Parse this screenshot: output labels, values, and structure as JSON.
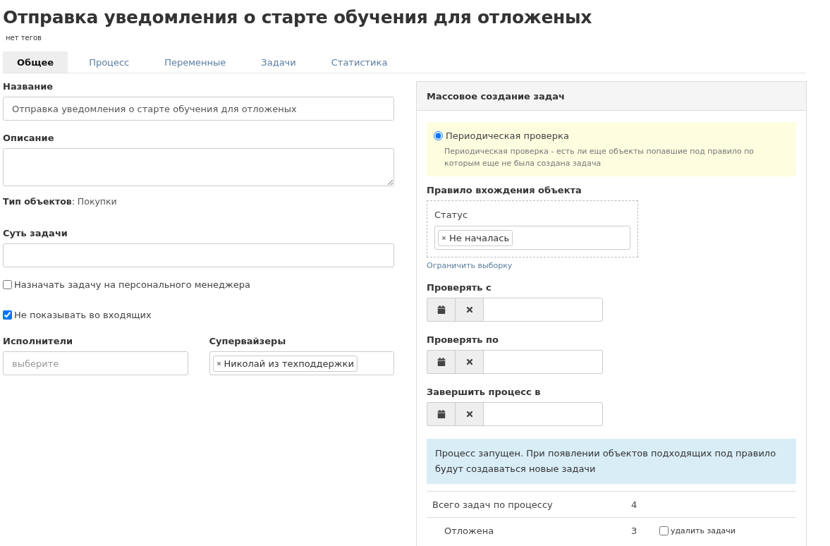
{
  "page": {
    "title": "Отправка уведомления о старте обучения для отложеных",
    "tags": "нет тегов"
  },
  "tabs": [
    {
      "label": "Общее",
      "selected": true
    },
    {
      "label": "Процесс",
      "selected": false
    },
    {
      "label": "Переменные",
      "selected": false
    },
    {
      "label": "Задачи",
      "selected": false
    },
    {
      "label": "Статистика",
      "selected": false
    }
  ],
  "form": {
    "name_label": "Название",
    "name_value": "Отправка уведомления о старте обучения для отложеных",
    "description_label": "Описание",
    "object_type_label": "Тип объектов",
    "object_type_value": ": Покупки",
    "task_label": "Суть задачи",
    "checkboxes": [
      {
        "label": "Назначать задачу на персонального менеджера",
        "checked": false
      },
      {
        "label": "Не показывать во входящих",
        "checked": true
      }
    ],
    "executors": {
      "label": "Исполнители",
      "placeholder": "выберите"
    },
    "supervisors": {
      "label": "Супервайзеры",
      "tags": [
        "Николай из техподдержки"
      ]
    }
  },
  "mass_panel": {
    "title": "Массовое создание задач",
    "mode": {
      "label": "Периодическая проверка",
      "selected": true,
      "description": "Периодическая проверка - есть ли еще объекты попавшие под правило по которым еще не была создана задача"
    },
    "rule_label": "Правило вхождения объекта",
    "rule": {
      "field_label": "Статус",
      "tags": [
        "Не началась"
      ]
    },
    "restrict_link": "Ограничить выборку",
    "date_fields": [
      {
        "label": "Проверять с"
      },
      {
        "label": "Проверять по"
      },
      {
        "label": "Завершить процесс в"
      }
    ],
    "info": "Процесс запущен. При появлении объектов подходящих под правило будут создаваться новые задачи",
    "stats": [
      {
        "kind": "total",
        "label": "Всего задач по процессу",
        "value": "4"
      },
      {
        "kind": "sub",
        "label": "Отложена",
        "value": "3",
        "delete_label": "удалить задачи",
        "checked": false
      }
    ]
  }
}
